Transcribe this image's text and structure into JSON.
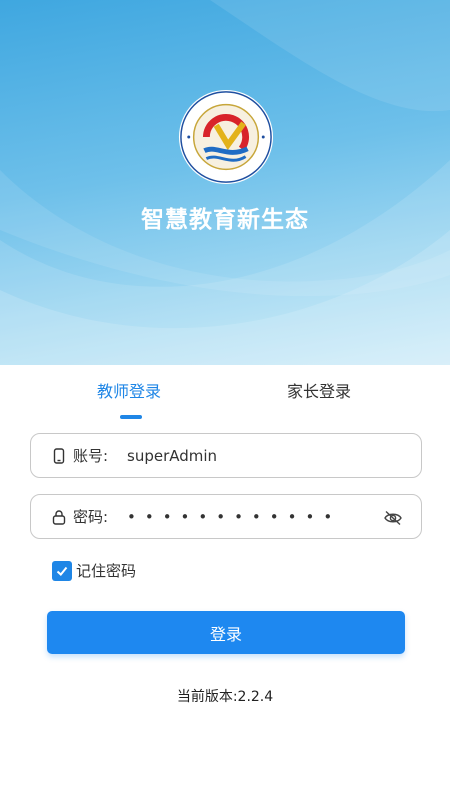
{
  "hero": {
    "slogan": "智慧教育新生态",
    "logo": {
      "icon": "school-emblem-icon",
      "ring_text_top": "东营市辰阳学校",
      "ring_text_bottom": "DONGYING CHENYANG SCHOOL"
    }
  },
  "tabs": [
    {
      "label": "教师登录",
      "active": true
    },
    {
      "label": "家长登录",
      "active": false
    }
  ],
  "account": {
    "label": "账号:",
    "value": "superAdmin",
    "icon": "phone-icon"
  },
  "password": {
    "label": "密码:",
    "masked": "••••••••••••",
    "icon": "lock-icon",
    "toggle_icon": "eye-off-icon"
  },
  "remember": {
    "label": "记住密码",
    "checked": true
  },
  "login_button": {
    "label": "登录"
  },
  "version": {
    "label": "当前版本:",
    "number": "2.2.4"
  },
  "colors": {
    "primary": "#1f86e6",
    "hero_top": "#3fa7e0",
    "hero_bottom": "#cdebf8"
  }
}
